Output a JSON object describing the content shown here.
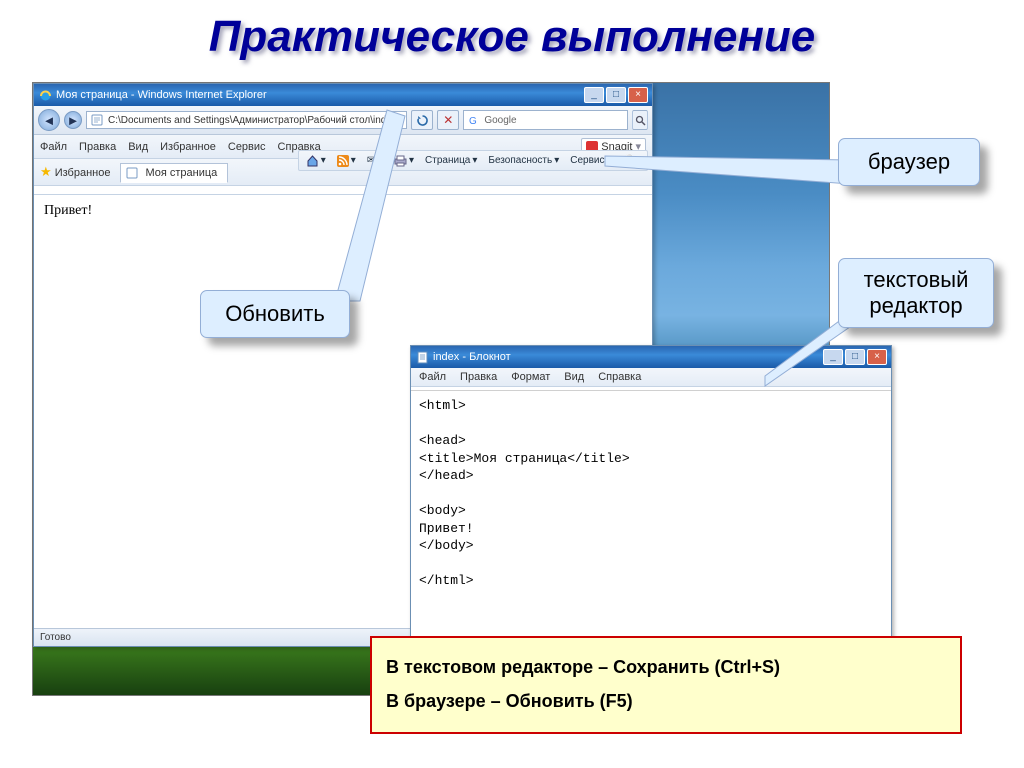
{
  "slide": {
    "title": "Практическое выполнение"
  },
  "browser": {
    "window_title": "Моя страница - Windows Internet Explorer",
    "address": "C:\\Documents and Settings\\Администратор\\Рабочий стол\\inde",
    "search_provider": "Google",
    "menu": {
      "file": "Файл",
      "edit": "Правка",
      "view": "Вид",
      "favorites": "Избранное",
      "tools": "Сервис",
      "help": "Справка"
    },
    "snagit_label": "Snagit",
    "favorites_label": "Избранное",
    "tab_title": "Моя страница",
    "command_bar": {
      "page": "Страница",
      "safety": "Безопасность",
      "service": "Сервис"
    },
    "page_content": "Привет!",
    "status": "Готово"
  },
  "notepad": {
    "window_title": "index - Блокнот",
    "menu": {
      "file": "Файл",
      "edit": "Правка",
      "format": "Формат",
      "view": "Вид",
      "help": "Справка"
    },
    "body": "<html>\n\n<head>\n<title>Моя страница</title>\n</head>\n\n<body>\nПривет!\n</body>\n\n</html>"
  },
  "callouts": {
    "refresh": "Обновить",
    "browser": "браузер",
    "editor_line1": "текстовый",
    "editor_line2": "редактор"
  },
  "instructions": {
    "line1": "В текстовом редакторе – Сохранить (Ctrl+S)",
    "line2": "В браузере – Обновить (F5)"
  }
}
